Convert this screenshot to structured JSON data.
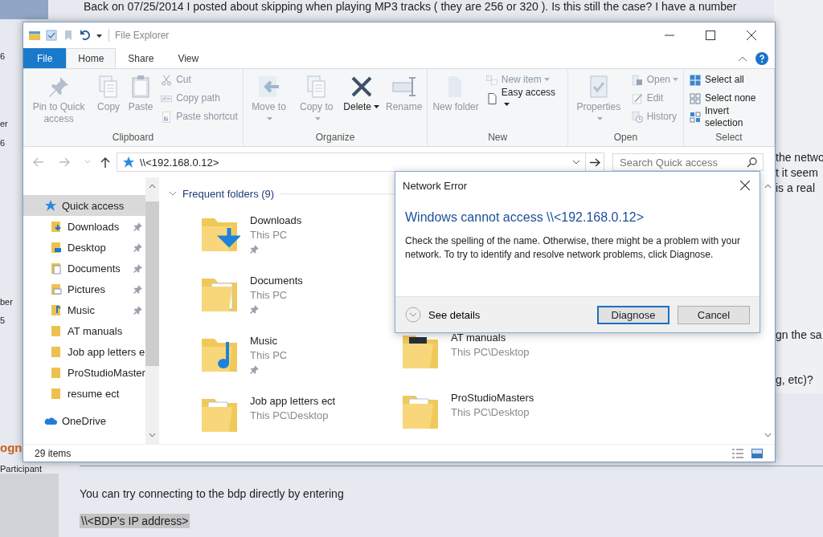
{
  "forum": {
    "post_text": "Back on 07/25/2014 I posted about skipping when playing MP3 tracks ( they are 256 or 320 ).  Is this still the case?  I have a number",
    "left_fragments": [
      "6",
      "er",
      "6",
      "ber",
      "5"
    ],
    "right_fragments": [
      "the netwo",
      "t it seem",
      "is a real",
      "gn the sa",
      "g, etc)?"
    ],
    "author": "ogn",
    "author_role": "Participant",
    "reply_text": "You can try connecting to the bdp directly by entering",
    "code_text": "\\\\<BDP’s IP address>"
  },
  "explorer": {
    "title": "File Explorer",
    "tabs": [
      {
        "label": "File",
        "kind": "file",
        "selected": false
      },
      {
        "label": "Home",
        "kind": "tab",
        "selected": true
      },
      {
        "label": "Share",
        "kind": "tab",
        "selected": false
      },
      {
        "label": "View",
        "kind": "tab",
        "selected": false
      }
    ],
    "ribbon_groups": [
      {
        "label": "Clipboard",
        "buttons": [
          {
            "label": "Pin to Quick access",
            "kind": "pin",
            "disabled": true,
            "dropdown": false
          },
          {
            "label": "Copy",
            "kind": "copy",
            "disabled": true,
            "dropdown": false
          },
          {
            "label": "Paste",
            "kind": "paste",
            "disabled": true,
            "dropdown": false
          },
          {
            "label": "Cut",
            "kind": "cut",
            "disabled": true,
            "dropdown": false
          },
          {
            "label": "Copy path",
            "kind": "copypath",
            "disabled": true,
            "dropdown": false
          },
          {
            "label": "Paste shortcut",
            "kind": "shortcut",
            "disabled": true,
            "dropdown": false
          }
        ]
      },
      {
        "label": "Organize",
        "buttons": [
          {
            "label": "Move to",
            "kind": "moveto",
            "disabled": true,
            "dropdown": true
          },
          {
            "label": "Copy to",
            "kind": "copyto",
            "disabled": true,
            "dropdown": true
          },
          {
            "label": "Delete",
            "kind": "delete",
            "disabled": false,
            "dropdown": true
          },
          {
            "label": "Rename",
            "kind": "rename",
            "disabled": true,
            "dropdown": false
          }
        ]
      },
      {
        "label": "New",
        "buttons": [
          {
            "label": "New folder",
            "kind": "newfolder",
            "disabled": true,
            "dropdown": false
          },
          {
            "label": "New item",
            "kind": "newitem",
            "disabled": true,
            "dropdown": true
          },
          {
            "label": "Easy access",
            "kind": "easyaccess",
            "disabled": false,
            "dropdown": true
          }
        ]
      },
      {
        "label": "Open",
        "buttons": [
          {
            "label": "Properties",
            "kind": "properties",
            "disabled": true,
            "dropdown": true
          },
          {
            "label": "Open",
            "kind": "open",
            "disabled": true,
            "dropdown": true
          },
          {
            "label": "Edit",
            "kind": "edit",
            "disabled": true,
            "dropdown": false
          },
          {
            "label": "History",
            "kind": "history",
            "disabled": true,
            "dropdown": false
          }
        ]
      },
      {
        "label": "Select",
        "buttons": [
          {
            "label": "Select all",
            "kind": "selectall",
            "disabled": false,
            "dropdown": false
          },
          {
            "label": "Select none",
            "kind": "selectnone",
            "disabled": false,
            "dropdown": false
          },
          {
            "label": "Invert selection",
            "kind": "invert",
            "disabled": false,
            "dropdown": false
          }
        ]
      }
    ],
    "address": "\\\\<192.168.0.12>",
    "search": {
      "placeholder": "Search Quick access"
    },
    "nav": [
      {
        "label": "Quick access",
        "kind": "star",
        "selected": true,
        "children": [
          {
            "label": "Downloads",
            "kind": "downloads",
            "pinned": true,
            "selected": false
          },
          {
            "label": "Desktop",
            "kind": "desktop",
            "pinned": true,
            "selected": false
          },
          {
            "label": "Documents",
            "kind": "documents",
            "pinned": true,
            "selected": false
          },
          {
            "label": "Pictures",
            "kind": "pictures",
            "pinned": true,
            "selected": false
          },
          {
            "label": "Music",
            "kind": "music",
            "pinned": true,
            "selected": false
          },
          {
            "label": "AT manuals",
            "kind": "folder",
            "pinned": false,
            "selected": false
          },
          {
            "label": "Job app letters e",
            "kind": "folder",
            "pinned": false,
            "selected": false
          },
          {
            "label": "ProStudioMaster",
            "kind": "folder",
            "pinned": false,
            "selected": false
          },
          {
            "label": "resume ect",
            "kind": "folder",
            "pinned": false,
            "selected": false
          }
        ]
      },
      {
        "label": "OneDrive",
        "kind": "cloud",
        "selected": false
      }
    ],
    "section": {
      "label": "Frequent folders (9)",
      "expanded": true
    },
    "folder_columns": [
      [
        {
          "name": "Downloads",
          "location": "This PC",
          "kind": "downloads",
          "pinned": true
        },
        {
          "name": "Documents",
          "location": "This PC",
          "kind": "documents",
          "pinned": true
        },
        {
          "name": "Music",
          "location": "This PC",
          "kind": "music",
          "pinned": true
        },
        {
          "name": "Job app letters ect",
          "location": "This PC\\Desktop",
          "kind": "letters",
          "pinned": false
        }
      ],
      [
        {
          "name": "AT manuals",
          "location": "This PC\\Desktop",
          "kind": "photo",
          "pinned": false
        },
        {
          "name": "ProStudioMasters",
          "location": "This PC\\Desktop",
          "kind": "papers",
          "pinned": false
        }
      ]
    ],
    "status": "29 items"
  },
  "dialog": {
    "title": "Network Error",
    "heading": "Windows cannot access \\\\<192.168.0.12>",
    "message": "Check the spelling of the name. Otherwise, there might be a problem with your network. To try to identify and resolve network problems, click Diagnose.",
    "details_label": "See details",
    "buttons": [
      {
        "label": "Diagnose",
        "default": true
      },
      {
        "label": "Cancel",
        "default": false
      }
    ]
  }
}
